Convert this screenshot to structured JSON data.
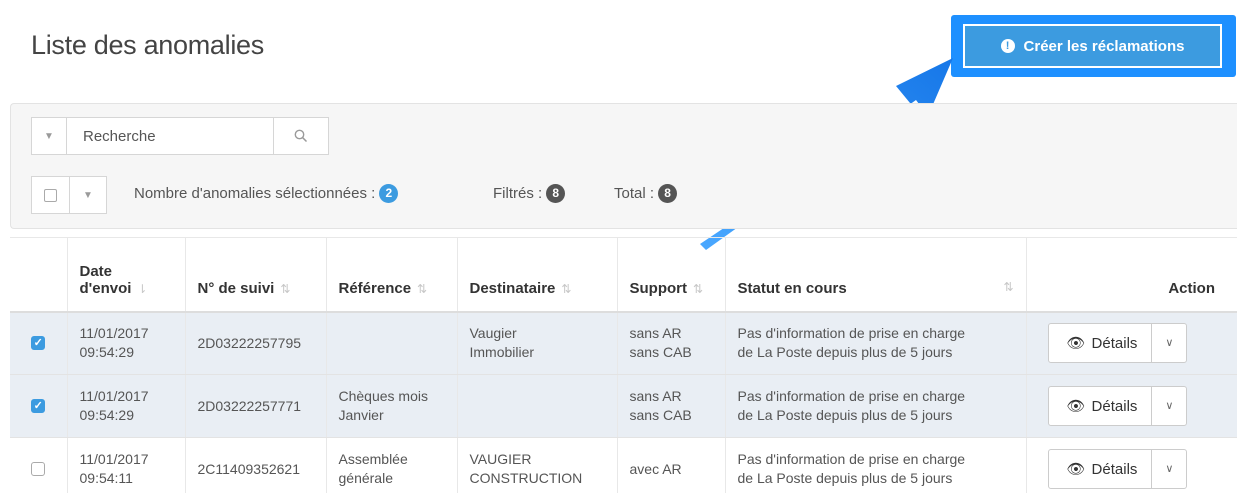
{
  "page": {
    "title": "Liste des anomalies"
  },
  "cta": {
    "label": "Créer les réclamations",
    "icon": "info-icon"
  },
  "filters": {
    "search_placeholder": "Recherche",
    "selected_label": "Nombre d'anomalies sélectionnées :",
    "selected_count": "2",
    "filtered_label": "Filtrés :",
    "filtered_count": "8",
    "total_label": "Total :",
    "total_count": "8"
  },
  "table": {
    "headers": {
      "date_line1": "Date",
      "date_line2": "d'envoi",
      "tracking": "N° de suivi",
      "reference": "Référence",
      "recipient": "Destinataire",
      "support": "Support",
      "status": "Statut en cours",
      "action": "Action"
    },
    "details_label": "Détails",
    "rows": [
      {
        "checked": true,
        "date": "11/01/2017",
        "time": "09:54:29",
        "tracking": "2D03222257795",
        "reference_line1": "",
        "reference_line2": "",
        "recipient_line1": "Vaugier",
        "recipient_line2": "Immobilier",
        "support_line1": "sans AR",
        "support_line2": "sans CAB",
        "status_line1": "Pas d'information de prise en charge",
        "status_line2": "de La Poste depuis plus de 5 jours"
      },
      {
        "checked": true,
        "date": "11/01/2017",
        "time": "09:54:29",
        "tracking": "2D03222257771",
        "reference_line1": "Chèques mois",
        "reference_line2": "Janvier",
        "recipient_line1": "",
        "recipient_line2": "",
        "support_line1": "sans AR",
        "support_line2": "sans CAB",
        "status_line1": "Pas d'information de prise en charge",
        "status_line2": "de La Poste depuis plus de 5 jours"
      },
      {
        "checked": false,
        "date": "11/01/2017",
        "time": "09:54:11",
        "tracking": "2C11409352621",
        "reference_line1": "Assemblée",
        "reference_line2": "générale",
        "recipient_line1": "VAUGIER",
        "recipient_line2": "CONSTRUCTION",
        "support_line1": "avec AR",
        "support_line2": "",
        "status_line1": "Pas d'information de prise en charge",
        "status_line2": "de La Poste depuis plus de 5 jours"
      }
    ]
  },
  "colors": {
    "accent": "#3c9be0",
    "highlight": "#1e90ff",
    "selected_row": "#e9eef4"
  }
}
